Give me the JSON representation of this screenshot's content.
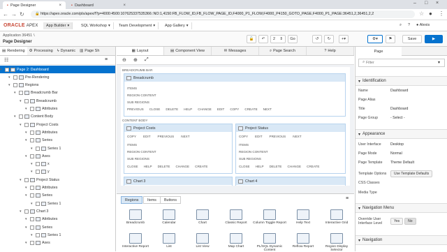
{
  "browser": {
    "tabs": [
      {
        "label": "Page Designer"
      },
      {
        "label": "Dashboard"
      }
    ],
    "url": "https://apex.oracle.com/pls/apex/f?p=4000:4500:10762533753536​6::NO:1,4150:FB_FLOW_ID,FB_FLOW_PAGE_ID,F4000_P1_FLOW,F4000_P4150_GOTO_PAGE,F4000_P1_PAGE:36451,2,36451,2,2"
  },
  "apex": {
    "logo": "ORACLE",
    "logo_sub": "APEX",
    "menus": [
      "App Builder",
      "SQL Workshop",
      "Team Development",
      "App Gallery"
    ],
    "user": "Alexis"
  },
  "toolbar": {
    "application": "Application 36451",
    "page_label": "Page Designer",
    "page_number": "2",
    "go": "Go",
    "save": "Save"
  },
  "left": {
    "tabs": [
      "Rendering",
      "Processing",
      "Dynamic",
      "Page Sh"
    ],
    "tree": [
      {
        "label": "Page 2: Dashboard",
        "level": 0,
        "selected": true
      },
      {
        "label": "Pre-Rendering",
        "level": 1
      },
      {
        "label": "Regions",
        "level": 1
      },
      {
        "label": "Breadcrumb Bar",
        "level": 2
      },
      {
        "label": "Breadcrumb",
        "level": 3
      },
      {
        "label": "Attributes",
        "level": 4
      },
      {
        "label": "Content Body",
        "level": 2
      },
      {
        "label": "Project Costs",
        "level": 3
      },
      {
        "label": "Attributes",
        "level": 4
      },
      {
        "label": "Series",
        "level": 4
      },
      {
        "label": "Series 1",
        "level": 5
      },
      {
        "label": "Axes",
        "level": 4
      },
      {
        "label": "x",
        "level": 5
      },
      {
        "label": "y",
        "level": 5
      },
      {
        "label": "Project Status",
        "level": 3
      },
      {
        "label": "Attributes",
        "level": 4
      },
      {
        "label": "Series",
        "level": 4
      },
      {
        "label": "Series 1",
        "level": 5
      },
      {
        "label": "Chart 3",
        "level": 3
      },
      {
        "label": "Attributes",
        "level": 4
      },
      {
        "label": "Series",
        "level": 4
      },
      {
        "label": "Series 1",
        "level": 5
      },
      {
        "label": "Axes",
        "level": 4
      }
    ]
  },
  "center": {
    "tabs": [
      "Layout",
      "Component View",
      "Messages",
      "Page Search",
      "Help"
    ],
    "breadcrumb_bar": "BREADCRUMB BAR",
    "content_body": "CONTENT BODY",
    "regions": [
      {
        "title": "Breadcrumb",
        "rows": [
          "ITEMS",
          "REGION CONTENT",
          "SUB REGIONS"
        ],
        "buttons": [
          "PREVIOUS",
          "CLOSE",
          "DELETE",
          "HELP",
          "CHANGE",
          "EDIT",
          "COPY",
          "CREATE",
          "NEXT"
        ]
      },
      {
        "title": "Project Costs",
        "top": [
          "COPY",
          "EDIT",
          "PREVIOUS",
          "NEXT"
        ],
        "rows": [
          "ITEMS",
          "REGION CONTENT",
          "SUB REGIONS"
        ],
        "buttons": [
          "CLOSE",
          "HELP",
          "DELETE",
          "CHANGE",
          "CREATE"
        ]
      },
      {
        "title": "Project Status",
        "top": [
          "COPY",
          "EDIT",
          "PREVIOUS",
          "NEXT"
        ],
        "rows": [
          "ITEMS",
          "REGION CONTENT",
          "SUB REGIONS"
        ],
        "buttons": [
          "CLOSE",
          "HELP",
          "DELETE",
          "CHANGE",
          "CREATE"
        ]
      },
      {
        "title": "Chart 3",
        "top": [
          "COPY",
          "EDIT",
          "PREVIOUS",
          "NEXT"
        ]
      },
      {
        "title": "Chart 4",
        "top": [
          "COPY",
          "EDIT",
          "PREVIOUS",
          "NEXT"
        ]
      }
    ],
    "gallery_tabs": [
      "Regions",
      "Items",
      "Buttons"
    ],
    "gallery": [
      "Breadcrumb",
      "Calendar",
      "Chart",
      "Classic Report",
      "Column Toggle Report",
      "Help Text",
      "Interactive Grid",
      "Interactive Report",
      "List",
      "List View",
      "Map Chart",
      "PL/SQL Dynamic Content",
      "Reflow Report",
      "Region Display Selector"
    ]
  },
  "right": {
    "tab": "Page",
    "filter_placeholder": "Filter",
    "identification": "Identification",
    "name_label": "Name",
    "name_value": "Dashboard",
    "alias_label": "Page Alias",
    "title_label": "Title",
    "title_value": "Dashboard",
    "group_label": "Page Group",
    "group_value": "- Select -",
    "appearance": "Appearance",
    "ui_label": "User Interface",
    "ui_value": "Desktop",
    "mode_label": "Page Mode",
    "mode_value": "Normal",
    "template_label": "Page Template",
    "template_value": "Theme Default",
    "options_label": "Template Options",
    "options_button": "Use Template Defaults",
    "css_label": "CSS Classes",
    "media_label": "Media Type",
    "navmenu": "Navigation Menu",
    "override_label": "Override User Interface Level",
    "yes": "Yes",
    "no": "No",
    "navigation": "Navigation"
  }
}
